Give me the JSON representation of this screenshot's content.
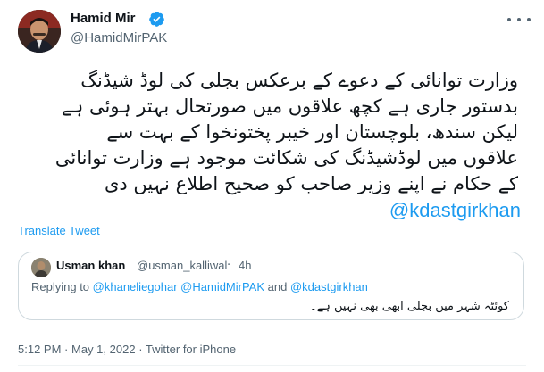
{
  "author": {
    "name": "Hamid Mir",
    "handle": "@HamidMirPAK",
    "verified": true
  },
  "tweet": {
    "lines": [
      "وزارت توانائی کے دعوے کے برعکس بجلی کی لوڈ شیڈنگ",
      "بدستور جاری ہے کچھ علاقوں میں صورتحال بہتر ہوئی ہے",
      "لیکن سندھ، بلوچستان اور خیبر پختونخوا کے بہت سے",
      "علاقوں میں لوڈشیڈنگ کی شکائت موجود ہے وزارت توانائی",
      "کے حکام نے اپنے وزیر صاحب کو صحیح اطلاع نہیں دی"
    ],
    "mention": "@kdastgirkhan",
    "translate_label": "Translate Tweet"
  },
  "quoted": {
    "name": "Usman khan",
    "handle": "@usman_kalliwal",
    "separator": "·",
    "time": "4h",
    "replying_prefix": "Replying to",
    "replying_to_1": "@khaneliegohar",
    "replying_to_2": "@HamidMirPAK",
    "replying_and": "and",
    "replying_to_3": "@kdastgirkhan",
    "text": "کوئٹہ شہر میں بجلی ابھی بھی نہیں ہے۔"
  },
  "footer": {
    "time": "5:12 PM",
    "separator": "·",
    "date": "May 1, 2022",
    "source_prefix": "·",
    "source": "Twitter for iPhone"
  },
  "colors": {
    "accent": "#1d9bf0",
    "text_primary": "#0f1419",
    "text_secondary": "#536471",
    "border": "#cfd9de"
  }
}
